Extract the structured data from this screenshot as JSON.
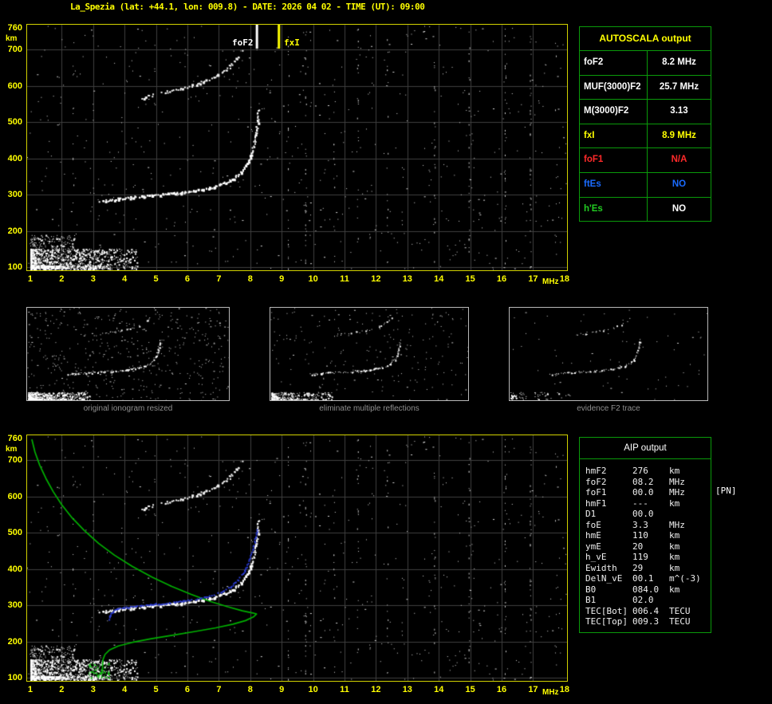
{
  "title": "La_Spezia (lat: +44.1, lon: 009.8) - DATE: 2026 04 02 - TIME (UT): 09:00",
  "colors": {
    "background": "#000000",
    "axis_yellow": "#ffff00",
    "plot_border": "#d2d200",
    "grid": "#3f3f3f",
    "echo_white": "#ffffff",
    "table_border": "#0a9a0a",
    "profile_green": "#00b000",
    "trace_blue": "#2b3bd0",
    "status_red": "#ff2a2a",
    "status_blue": "#1a6bff",
    "status_green": "#22cc22",
    "caption_gray": "#8f8f8f"
  },
  "autoscala_table": {
    "header": "AUTOSCALA output",
    "rows": [
      {
        "label": "foF2",
        "value": "8.2 MHz",
        "color": "white"
      },
      {
        "label": "MUF(3000)F2",
        "value": "25.7 MHz",
        "color": "white"
      },
      {
        "label": "M(3000)F2",
        "value": "3.13",
        "color": "white"
      },
      {
        "label": "fxI",
        "value": "8.9 MHz",
        "color": "yellow"
      },
      {
        "label": "foF1",
        "value": "N/A",
        "color": "red"
      },
      {
        "label": "ftEs",
        "value": "NO",
        "color": "blue"
      },
      {
        "label": "h'Es",
        "value": "NO",
        "color": "green"
      }
    ]
  },
  "thumbnails": [
    {
      "caption": "original ionogram resized"
    },
    {
      "caption": "eliminate multiple reflections"
    },
    {
      "caption": "evidence F2 trace"
    }
  ],
  "aip_table": {
    "header": "AIP output",
    "note": "[PN]",
    "rows": [
      {
        "name": "hmF2",
        "value": "276",
        "unit": "km"
      },
      {
        "name": "foF2",
        "value": "08.2",
        "unit": "MHz"
      },
      {
        "name": "foF1",
        "value": "00.0",
        "unit": "MHz"
      },
      {
        "name": "hmF1",
        "value": "---",
        "unit": "km"
      },
      {
        "name": "D1",
        "value": "00.0",
        "unit": ""
      },
      {
        "name": "foE",
        "value": "3.3",
        "unit": "MHz"
      },
      {
        "name": "hmE",
        "value": "110",
        "unit": "km"
      },
      {
        "name": "ymE",
        "value": "20",
        "unit": "km"
      },
      {
        "name": "h_vE",
        "value": "119",
        "unit": "km"
      },
      {
        "name": "Ewidth",
        "value": "29",
        "unit": "km"
      },
      {
        "name": "DelN_vE",
        "value": "00.1",
        "unit": "m^(-3)"
      },
      {
        "name": "B0",
        "value": "084.0",
        "unit": "km"
      },
      {
        "name": "B1",
        "value": "02.0",
        "unit": ""
      },
      {
        "name": "TEC[Bot]",
        "value": "006.4",
        "unit": "TECU"
      },
      {
        "name": "TEC[Top]",
        "value": "009.3",
        "unit": "TECU"
      }
    ]
  },
  "chart_data": {
    "type": "scatter",
    "title": "Ionogram",
    "xlabel": "MHz",
    "ylabel": "km",
    "xlim": [
      1,
      18
    ],
    "ylim": [
      100,
      760
    ],
    "grid": true,
    "xticks": [
      1,
      2,
      3,
      4,
      5,
      6,
      7,
      8,
      9,
      10,
      11,
      12,
      13,
      14,
      15,
      16,
      17,
      18
    ],
    "yticks": [
      100,
      200,
      300,
      400,
      500,
      600,
      700,
      760
    ],
    "markers": [
      {
        "label": "foF2",
        "x": 8.2,
        "color": "#ffffff"
      },
      {
        "label": "fxI",
        "x": 8.9,
        "color": "#ffff00"
      }
    ],
    "series": {
      "f2_trace": [
        [
          3.2,
          283
        ],
        [
          3.55,
          286
        ],
        [
          3.8,
          290
        ],
        [
          4.2,
          294
        ],
        [
          4.7,
          298
        ],
        [
          5.2,
          302
        ],
        [
          5.7,
          306
        ],
        [
          6.2,
          312
        ],
        [
          6.7,
          320
        ],
        [
          7.1,
          331
        ],
        [
          7.45,
          345
        ],
        [
          7.7,
          363
        ],
        [
          7.9,
          388
        ],
        [
          8.03,
          415
        ],
        [
          8.12,
          445
        ],
        [
          8.18,
          475
        ],
        [
          8.22,
          505
        ],
        [
          8.25,
          535
        ]
      ],
      "second_hop_trace": [
        [
          4.55,
          568
        ],
        [
          4.95,
          577
        ],
        [
          5.35,
          585
        ],
        [
          5.75,
          593
        ],
        [
          6.15,
          602
        ],
        [
          6.5,
          612
        ],
        [
          6.8,
          624
        ],
        [
          7.1,
          638
        ],
        [
          7.35,
          655
        ],
        [
          7.55,
          674
        ],
        [
          7.7,
          696
        ]
      ],
      "profile_green": [
        [
          1.05,
          757
        ],
        [
          1.15,
          722
        ],
        [
          1.3,
          686
        ],
        [
          1.5,
          649
        ],
        [
          1.73,
          613
        ],
        [
          2.0,
          577
        ],
        [
          2.33,
          541
        ],
        [
          2.72,
          506
        ],
        [
          3.17,
          471
        ],
        [
          3.68,
          438
        ],
        [
          4.25,
          407
        ],
        [
          4.87,
          378
        ],
        [
          5.5,
          352
        ],
        [
          6.12,
          330
        ],
        [
          6.72,
          311
        ],
        [
          7.28,
          296
        ],
        [
          7.75,
          285
        ],
        [
          8.08,
          279
        ],
        [
          8.2,
          276
        ],
        [
          8.1,
          268
        ],
        [
          7.85,
          258
        ],
        [
          7.45,
          248
        ],
        [
          6.9,
          238
        ],
        [
          6.25,
          228
        ],
        [
          5.55,
          218
        ],
        [
          4.85,
          208
        ],
        [
          4.25,
          198
        ],
        [
          3.8,
          188
        ],
        [
          3.52,
          177
        ],
        [
          3.38,
          165
        ],
        [
          3.32,
          152
        ],
        [
          3.3,
          140
        ],
        [
          3.3,
          128
        ],
        [
          3.28,
          116
        ],
        [
          3.25,
          108
        ]
      ],
      "autoscala_trace_blue": [
        [
          3.5,
          260
        ],
        [
          3.52,
          271
        ],
        [
          3.58,
          281
        ],
        [
          3.68,
          288
        ],
        [
          3.85,
          293
        ],
        [
          4.1,
          296
        ],
        [
          4.5,
          300
        ],
        [
          4.95,
          304
        ],
        [
          5.4,
          308
        ],
        [
          5.85,
          313
        ],
        [
          6.3,
          319
        ],
        [
          6.7,
          327
        ],
        [
          7.05,
          338
        ],
        [
          7.35,
          352
        ],
        [
          7.6,
          371
        ],
        [
          7.8,
          396
        ],
        [
          7.95,
          424
        ],
        [
          8.06,
          454
        ],
        [
          8.14,
          483
        ],
        [
          8.2,
          510
        ]
      ]
    },
    "noise": {
      "rfi_frequencies": [
        2.35,
        9.2,
        9.75,
        10.65,
        11.4,
        12.35,
        13.85,
        14.95,
        16.1,
        16.9,
        17.7
      ],
      "cluster_regions": [
        [
          1.0,
          4.4,
          95,
          152
        ],
        [
          1.0,
          2.4,
          150,
          190
        ],
        [
          1.0,
          3.6,
          95,
          106
        ]
      ],
      "green_cluster_region": [
        2.85,
        3.5,
        100,
        142
      ]
    }
  }
}
